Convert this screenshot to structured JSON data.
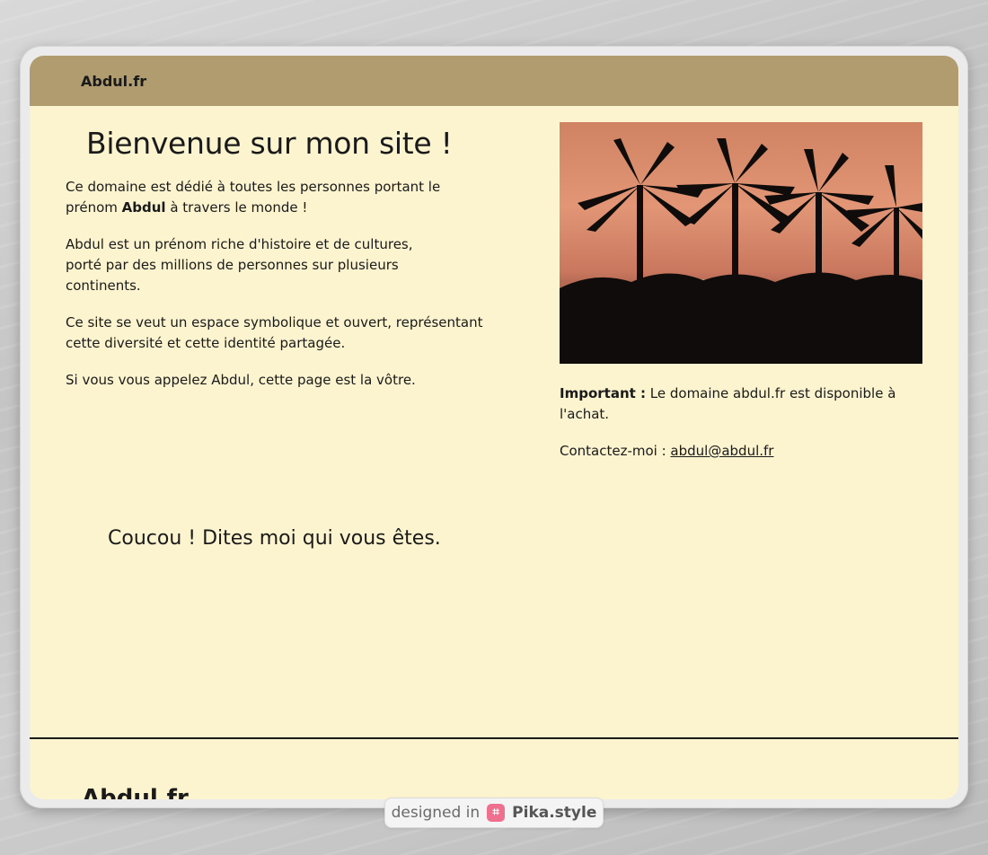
{
  "header": {
    "brand": "Abdul.fr"
  },
  "main": {
    "title": "Bienvenue sur mon site !",
    "intro_before": "Ce domaine est dédié à toutes les personnes portant le prénom ",
    "intro_bold": "Abdul",
    "intro_after": " à travers le monde !",
    "paragraph_2": "Abdul est un prénom riche d'histoire et de cultures, porté par des millions de personnes sur plusieurs continents.",
    "paragraph_3": "Ce site se veut un espace symbolique et ouvert, représentant cette diversité et cette identité partagée.",
    "paragraph_4": "Si vous vous appelez Abdul, cette page est la vôtre.",
    "greeting": "Coucou ! Dites moi qui vous êtes."
  },
  "aside": {
    "image_alt": "palm-trees-sunset-photo",
    "important_label": "Important :",
    "important_text": " Le domaine abdul.fr est disponible à l'achat.",
    "contact_label": "Contactez-moi : ",
    "contact_email": "abdul@abdul.fr"
  },
  "footer": {
    "brand_partial": "Abdul.fr"
  },
  "badge": {
    "prefix": "designed in",
    "name": "Pika.style",
    "icon": "pika-crop-icon"
  },
  "colors": {
    "header": "#b19c6f",
    "page": "#fcf3cf",
    "text": "#1a1a1a",
    "pika_accent": "#ef6f8e"
  }
}
